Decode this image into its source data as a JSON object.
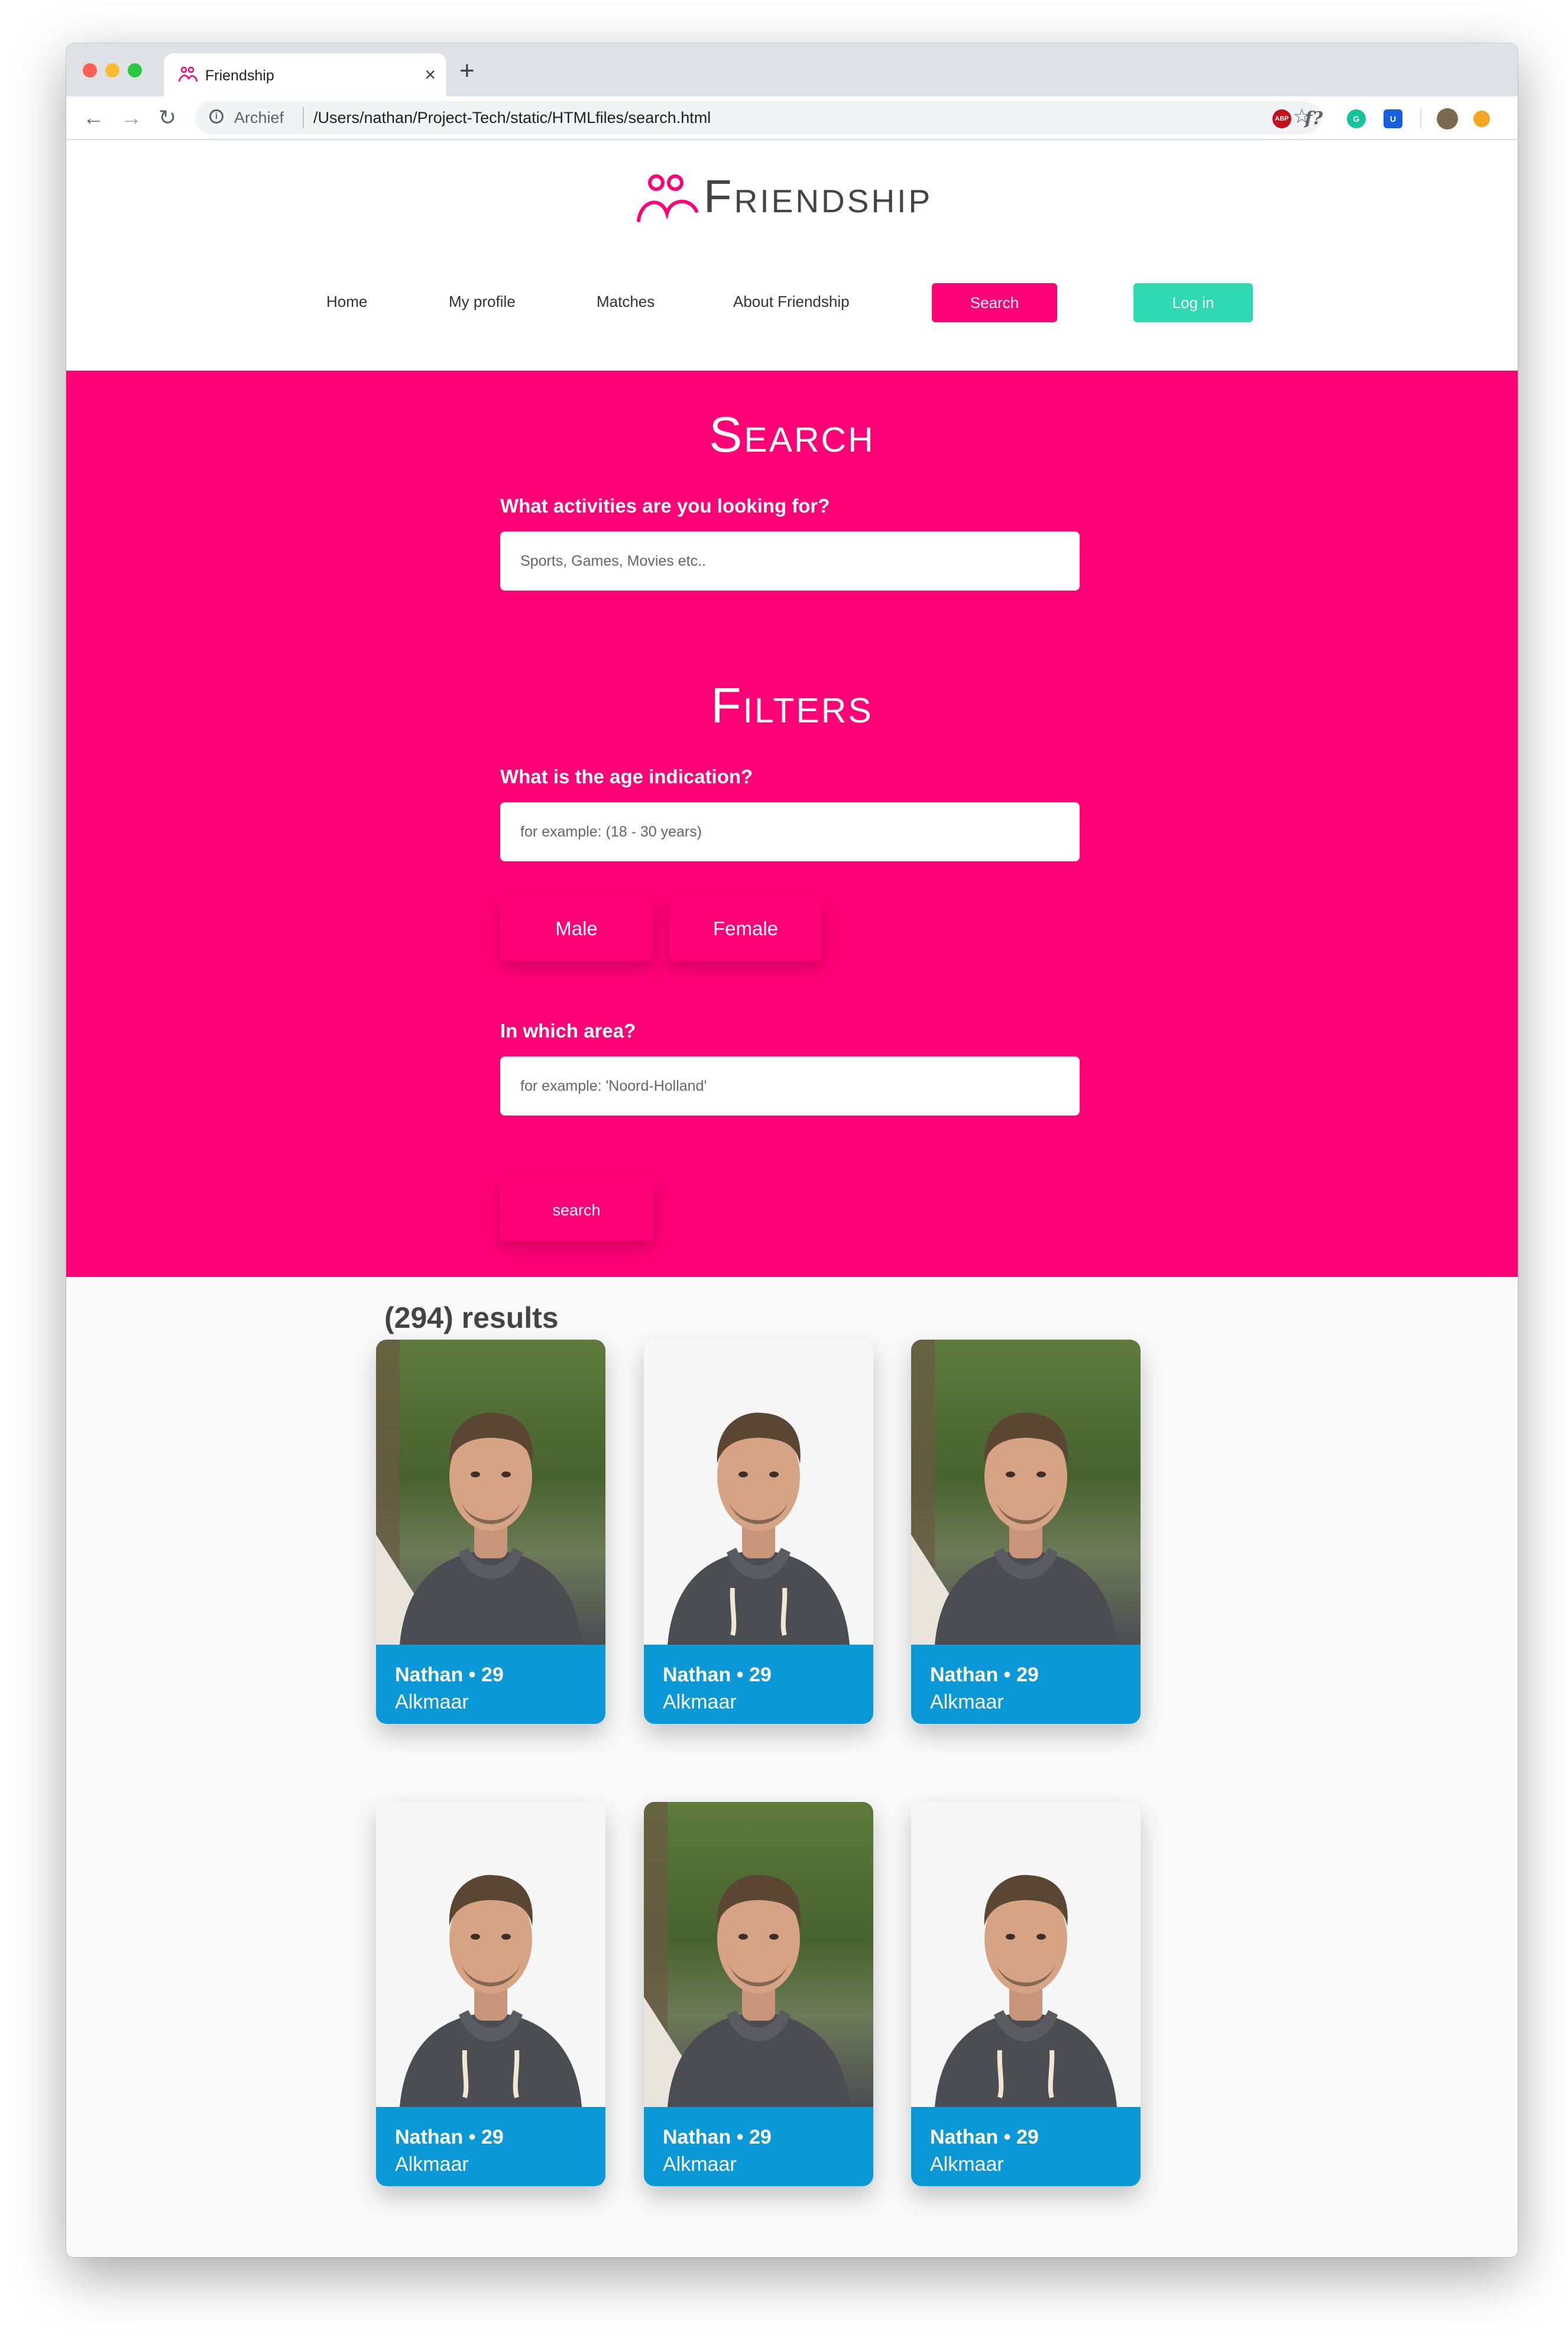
{
  "browser": {
    "tab_title": "Friendship",
    "tab_close": "×",
    "new_tab": "+",
    "back_icon": "←",
    "forward_icon": "→",
    "reload_icon": "↻",
    "url_label": "Archief",
    "url_path": "/Users/nathan/Project-Tech/static/HTMLfiles/search.html",
    "star_icon": "☆",
    "extensions": {
      "abp": "ABP",
      "f": "f?",
      "grammarly": "G",
      "bitwarden": "U"
    }
  },
  "site": {
    "logo_text": "Friendship",
    "nav": {
      "home": "Home",
      "profile": "My profile",
      "matches": "Matches",
      "about": "About Friendship",
      "search": "Search",
      "login": "Log in"
    },
    "colors": {
      "brand_pink": "#ff0076",
      "login_teal": "#2ed8b0",
      "card_blue": "#0a99d6"
    }
  },
  "search": {
    "title": "Search",
    "activities_label": "What activities are you looking for?",
    "activities_placeholder": "Sports, Games, Movies etc.."
  },
  "filters": {
    "title": "Filters",
    "age_label": "What is the age indication?",
    "age_placeholder": "for example: (18 - 30 years)",
    "male": "Male",
    "female": "Female",
    "area_label": "In which area?",
    "area_placeholder": "for example: 'Noord-Holland'",
    "search_button": "search"
  },
  "results": {
    "title": "(294) results",
    "cards": [
      {
        "name": "Nathan • 29",
        "city": "Alkmaar",
        "photo": "outdoor"
      },
      {
        "name": "Nathan • 29",
        "city": "Alkmaar",
        "photo": "white"
      },
      {
        "name": "Nathan • 29",
        "city": "Alkmaar",
        "photo": "outdoor"
      },
      {
        "name": "Nathan • 29",
        "city": "Alkmaar",
        "photo": "white"
      },
      {
        "name": "Nathan • 29",
        "city": "Alkmaar",
        "photo": "outdoor"
      },
      {
        "name": "Nathan • 29",
        "city": "Alkmaar",
        "photo": "white"
      }
    ]
  }
}
